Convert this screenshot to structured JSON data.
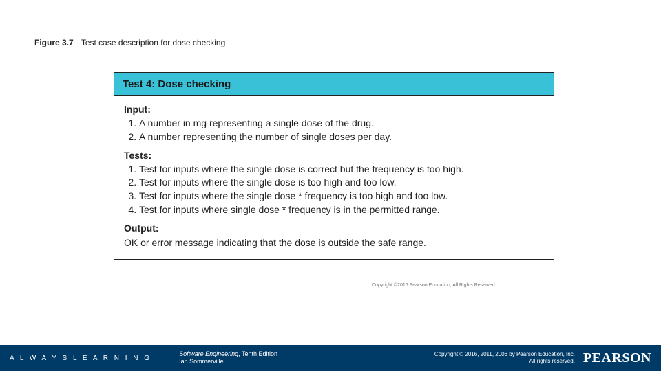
{
  "caption": {
    "fignum": "Figure 3.7",
    "text": "Test case description for dose checking"
  },
  "card": {
    "header": "Test 4: Dose checking",
    "sections": {
      "input_label": "Input:",
      "inputs": [
        "A number in mg representing a single dose of the drug.",
        "A number representing the number of single doses per day."
      ],
      "tests_label": "Tests:",
      "tests": [
        "Test for inputs where the single dose is correct but the frequency is too high.",
        "Test for inputs where the single dose is too high and too low.",
        "Test for inputs where the single dose * frequency is too high and too low.",
        "Test for inputs where single dose * frequency is in the permitted range."
      ],
      "output_label": "Output:",
      "output_text": "OK or error message indicating that the dose is outside the safe range."
    }
  },
  "mini_copyright": "Copyright ©2016 Pearson Education, All Rights Reserved",
  "footer": {
    "always": "A L W A Y S   L E A R N I N G",
    "book_title": "Software Engineering",
    "book_edition": ", Tenth Edition",
    "author": "Ian Sommerville",
    "copyright_line1": "Copyright © 2016, 2011, 2006 by Pearson Education, Inc.",
    "copyright_line2": "All rights reserved.",
    "logo": "PEARSON"
  }
}
